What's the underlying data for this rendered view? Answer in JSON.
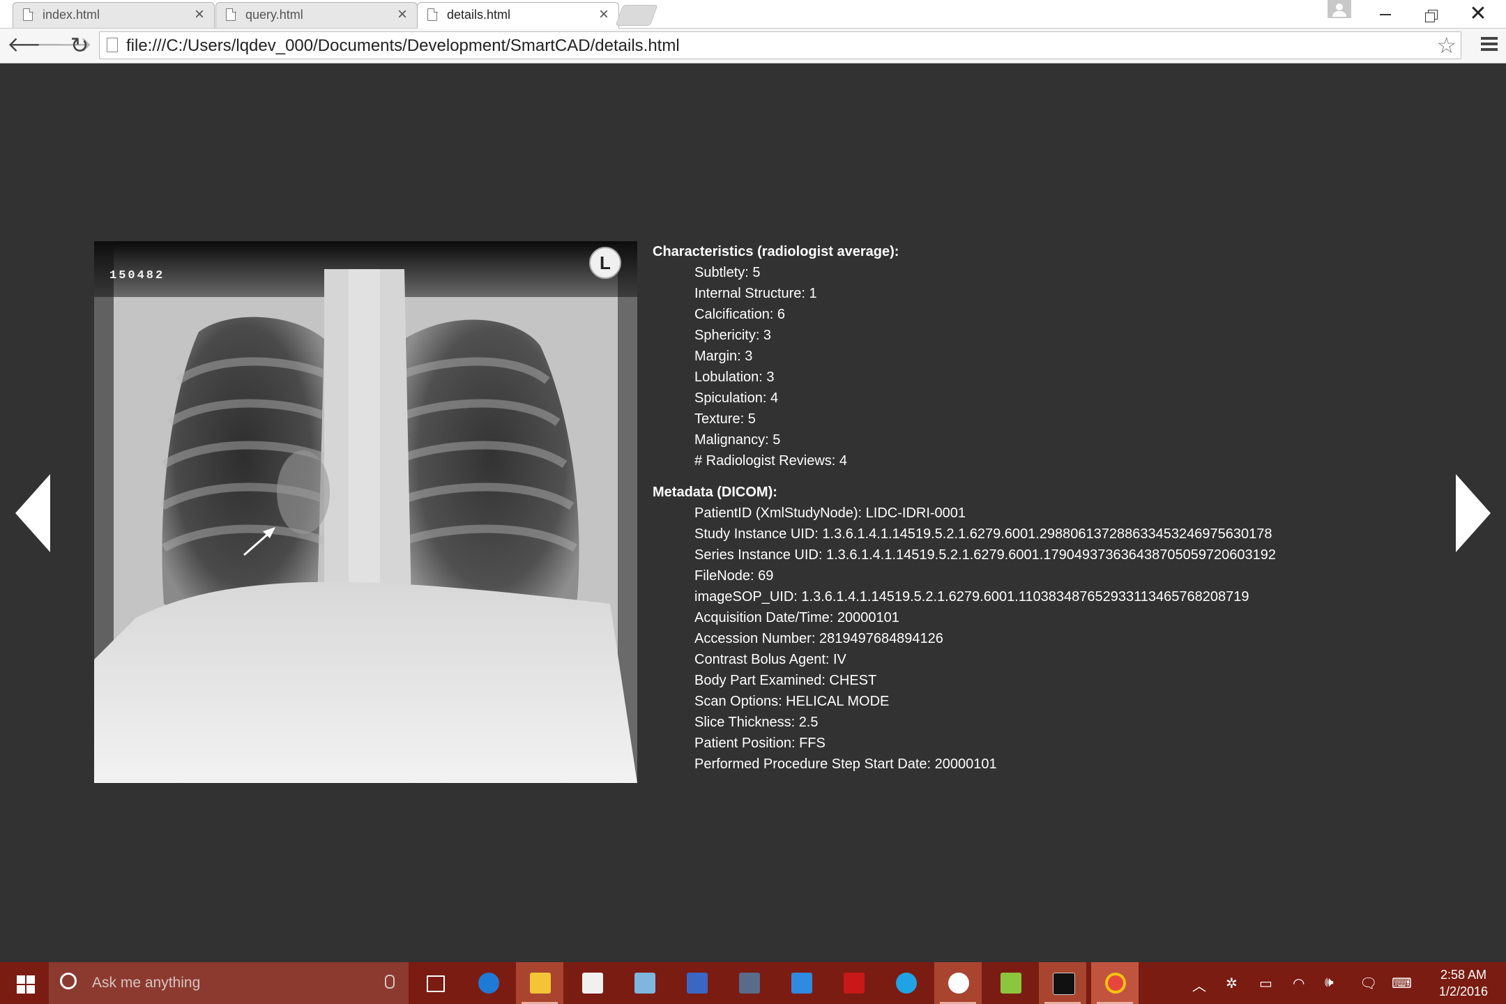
{
  "browser": {
    "tabs": [
      {
        "title": "index.html",
        "active": false
      },
      {
        "title": "query.html",
        "active": false
      },
      {
        "title": "details.html",
        "active": true
      }
    ],
    "tab_close_glyph": "×",
    "url": "file:///C:/Users/lqdev_000/Documents/Development/SmartCAD/details.html"
  },
  "image": {
    "film_number": "150482",
    "side_marker": "L"
  },
  "characteristics": {
    "title": "Characteristics (radiologist average):",
    "items": [
      "Subtlety: 5",
      "Internal Structure: 1",
      "Calcification: 6",
      "Sphericity: 3",
      "Margin: 3",
      "Lobulation: 3",
      "Spiculation: 4",
      "Texture: 5",
      "Malignancy: 5",
      "# Radiologist Reviews: 4"
    ]
  },
  "metadata": {
    "title": "Metadata (DICOM):",
    "items": [
      "PatientID (XmlStudyNode): LIDC-IDRI-0001",
      "Study Instance UID: 1.3.6.1.4.1.14519.5.2.1.6279.6001.298806137288633453246975630178",
      "Series Instance UID: 1.3.6.1.4.1.14519.5.2.1.6279.6001.179049373636438705059720603192",
      "FileNode: 69",
      "imageSOP_UID: 1.3.6.1.4.1.14519.5.2.1.6279.6001.110383487652933113465768208719",
      "Acquisition Date/Time: 20000101",
      "Accession Number: 2819497684894126",
      "Contrast Bolus Agent: IV",
      "Body Part Examined: CHEST",
      "Scan Options: HELICAL MODE",
      "Slice Thickness: 2.5",
      "Patient Position: FFS",
      "Performed Procedure Step Start Date: 20000101"
    ]
  },
  "taskbar": {
    "search_placeholder": "Ask me anything",
    "apps": [
      "task-view",
      "edge",
      "file-explorer",
      "store",
      "photos",
      "network-app",
      "file-app",
      "visual-studio",
      "filezilla",
      "skype",
      "slack",
      "notepad-app",
      "command-prompt",
      "chrome"
    ],
    "clock_time": "2:58 AM",
    "clock_date": "1/2/2016"
  },
  "colors": {
    "page_background": "#323232",
    "text": "#ffffff",
    "taskbar": "#7a1c12"
  }
}
